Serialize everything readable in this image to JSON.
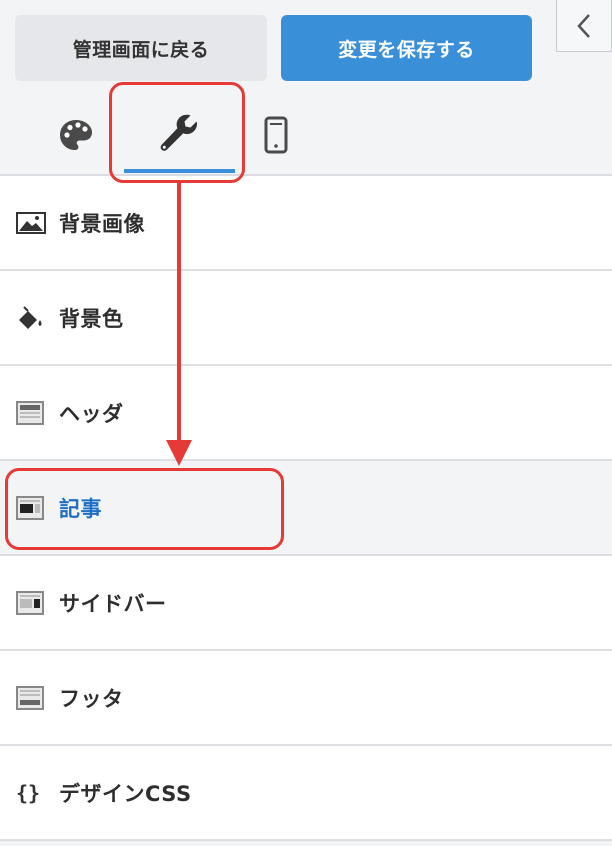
{
  "toolbar": {
    "back_label": "管理画面に戻る",
    "save_label": "変更を保存する"
  },
  "tabs": [
    {
      "icon": "palette-icon"
    },
    {
      "icon": "wrench-icon",
      "selected": true
    },
    {
      "icon": "mobile-icon"
    }
  ],
  "menu": {
    "items": [
      {
        "label": "背景画像",
        "icon": "image-icon"
      },
      {
        "label": "背景色",
        "icon": "paint-bucket-icon"
      },
      {
        "label": "ヘッダ",
        "icon": "layout-header-icon"
      },
      {
        "label": "記事",
        "icon": "layout-article-icon",
        "active": true
      },
      {
        "label": "サイドバー",
        "icon": "layout-sidebar-icon"
      },
      {
        "label": "フッタ",
        "icon": "layout-footer-icon"
      },
      {
        "label": "デザインCSS",
        "icon": "braces-icon",
        "icon_text": "{}"
      }
    ]
  },
  "colors": {
    "accent": "#3a8fd9",
    "active_text": "#1f6fc5",
    "annotation": "#e53a35"
  }
}
